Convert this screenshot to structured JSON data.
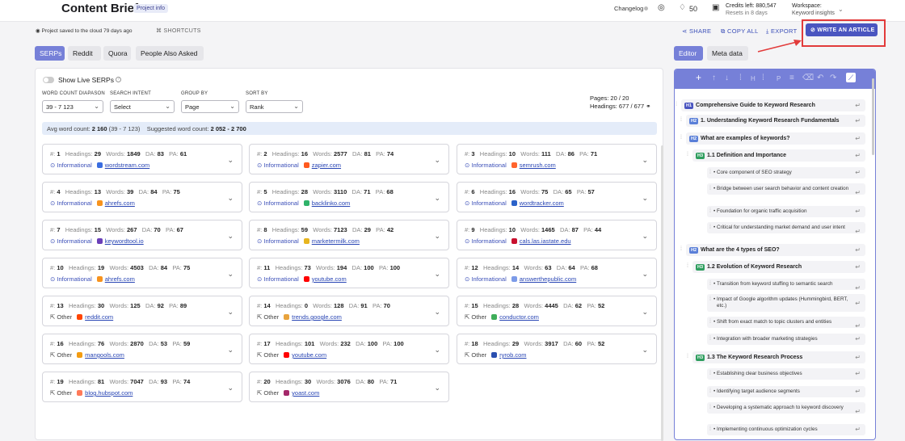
{
  "header": {
    "title": "Content Brief",
    "project_badge": "Project info",
    "changelog": "Changelog",
    "notifications": "50",
    "credits_label": "Credits left: 880,547",
    "credits_sub": "Resets in 8 days",
    "workspace_label": "Workspace:",
    "workspace_value": "Keyword insights"
  },
  "subbar": {
    "saved": "Project saved to the cloud 79 days ago",
    "shortcuts": "SHORTCUTS",
    "share": "SHARE",
    "copy_all": "COPY ALL",
    "export": "EXPORT",
    "write_article": "WRITE AN ARTICLE"
  },
  "left_tabs": [
    "SERPs",
    "Reddit",
    "Quora",
    "People Also Asked"
  ],
  "right_tabs": [
    "Editor",
    "Meta data"
  ],
  "filters": {
    "show_live": "Show Live SERPs",
    "word_count_label": "WORD COUNT DIAPASON",
    "word_count_value": "39 - 7 123",
    "intent_label": "SEARCH INTENT",
    "intent_value": "Select",
    "group_label": "GROUP BY",
    "group_value": "Page",
    "sort_label": "SORT BY",
    "sort_value": "Rank",
    "pages": "Pages: 20 / 20",
    "headings": "Headings: 677 / 677"
  },
  "avg": {
    "avg_label": "Avg word count:",
    "avg_value": "2 160",
    "avg_range": "(39 - 7 123)",
    "sugg_label": "Suggested word count:",
    "sugg_value": "2 052 - 2 700"
  },
  "labels": {
    "num": "#:",
    "headings": "Headings:",
    "words": "Words:",
    "da": "DA:",
    "pa": "PA:"
  },
  "cards": [
    {
      "n": "1",
      "h": "29",
      "w": "1849",
      "da": "83",
      "pa": "61",
      "intent": "Informational",
      "domain": "wordstream.com",
      "color": "#3a6de0"
    },
    {
      "n": "2",
      "h": "16",
      "w": "2577",
      "da": "81",
      "pa": "74",
      "intent": "Informational",
      "domain": "zapier.com",
      "color": "#ff5a1f"
    },
    {
      "n": "3",
      "h": "10",
      "w": "111",
      "da": "86",
      "pa": "71",
      "intent": "Informational",
      "domain": "semrush.com",
      "color": "#ff642d"
    },
    {
      "n": "4",
      "h": "13",
      "w": "39",
      "da": "84",
      "pa": "75",
      "intent": "Informational",
      "domain": "ahrefs.com",
      "color": "#f7931e"
    },
    {
      "n": "5",
      "h": "28",
      "w": "3110",
      "da": "71",
      "pa": "68",
      "intent": "Informational",
      "domain": "backlinko.com",
      "color": "#2fb36a"
    },
    {
      "n": "6",
      "h": "16",
      "w": "75",
      "da": "65",
      "pa": "57",
      "intent": "Informational",
      "domain": "wordtracker.com",
      "color": "#2a62c9"
    },
    {
      "n": "7",
      "h": "15",
      "w": "267",
      "da": "70",
      "pa": "67",
      "intent": "Informational",
      "domain": "keywordtool.io",
      "color": "#6a3fb8"
    },
    {
      "n": "8",
      "h": "59",
      "w": "7123",
      "da": "29",
      "pa": "42",
      "intent": "Informational",
      "domain": "marketermilk.com",
      "color": "#e7b51f"
    },
    {
      "n": "9",
      "h": "10",
      "w": "1465",
      "da": "87",
      "pa": "44",
      "intent": "Informational",
      "domain": "cals.las.iastate.edu",
      "color": "#c8102e"
    },
    {
      "n": "10",
      "h": "19",
      "w": "4503",
      "da": "84",
      "pa": "75",
      "intent": "Informational",
      "domain": "ahrefs.com",
      "color": "#f7931e"
    },
    {
      "n": "11",
      "h": "73",
      "w": "194",
      "da": "100",
      "pa": "100",
      "intent": "Informational",
      "domain": "youtube.com",
      "color": "#ff0000"
    },
    {
      "n": "12",
      "h": "14",
      "w": "63",
      "da": "64",
      "pa": "68",
      "intent": "Informational",
      "domain": "answerthepublic.com",
      "color": "#7c9be8"
    },
    {
      "n": "13",
      "h": "30",
      "w": "125",
      "da": "92",
      "pa": "89",
      "intent": "Other",
      "domain": "reddit.com",
      "color": "#ff4500"
    },
    {
      "n": "14",
      "h": "0",
      "w": "128",
      "da": "91",
      "pa": "70",
      "intent": "Other",
      "domain": "trends.google.com",
      "color": "#e8a33d"
    },
    {
      "n": "15",
      "h": "28",
      "w": "4445",
      "da": "62",
      "pa": "52",
      "intent": "Other",
      "domain": "conductor.com",
      "color": "#3fae5a"
    },
    {
      "n": "16",
      "h": "76",
      "w": "2870",
      "da": "53",
      "pa": "59",
      "intent": "Other",
      "domain": "mangools.com",
      "color": "#f39c12"
    },
    {
      "n": "17",
      "h": "101",
      "w": "232",
      "da": "100",
      "pa": "100",
      "intent": "Other",
      "domain": "youtube.com",
      "color": "#ff0000"
    },
    {
      "n": "18",
      "h": "29",
      "w": "3917",
      "da": "60",
      "pa": "52",
      "intent": "Other",
      "domain": "ryrob.com",
      "color": "#2a4fb0"
    },
    {
      "n": "19",
      "h": "81",
      "w": "7047",
      "da": "93",
      "pa": "74",
      "intent": "Other",
      "domain": "blog.hubspot.com",
      "color": "#ff7a59"
    },
    {
      "n": "20",
      "h": "30",
      "w": "3076",
      "da": "80",
      "pa": "71",
      "intent": "Other",
      "domain": "yoast.com",
      "color": "#a4286a"
    }
  ],
  "outline": [
    {
      "type": "H1",
      "text": "Comprehensive Guide to Keyword Research"
    },
    {
      "type": "H2",
      "text": "1. Understanding Keyword Research Fundamentals"
    },
    {
      "type": "H2",
      "text": "What are examples of keywords?"
    },
    {
      "type": "H3",
      "text": "1.1 Definition and Importance"
    },
    {
      "type": "li",
      "text": "Core component of SEO strategy"
    },
    {
      "type": "li",
      "text": "Bridge between user search behavior and content creation"
    },
    {
      "type": "li",
      "text": "Foundation for organic traffic acquisition"
    },
    {
      "type": "li",
      "text": "Critical for understanding market demand and user intent"
    },
    {
      "type": "H2",
      "text": "What are the 4 types of SEO?"
    },
    {
      "type": "H3",
      "text": "1.2 Evolution of Keyword Research"
    },
    {
      "type": "li",
      "text": "Transition from keyword stuffing to semantic search"
    },
    {
      "type": "li",
      "text": "Impact of Google algorithm updates (Hummingbird, BERT, etc.)"
    },
    {
      "type": "li",
      "text": "Shift from exact match to topic clusters and entities"
    },
    {
      "type": "li",
      "text": "Integration with broader marketing strategies"
    },
    {
      "type": "H3",
      "text": "1.3 The Keyword Research Process"
    },
    {
      "type": "li",
      "text": "Establishing clear business objectives"
    },
    {
      "type": "li",
      "text": "Identifying target audience segments"
    },
    {
      "type": "li",
      "text": "Developing a systematic approach to keyword discovery"
    },
    {
      "type": "li",
      "text": "Implementing continuous optimization cycles"
    }
  ]
}
